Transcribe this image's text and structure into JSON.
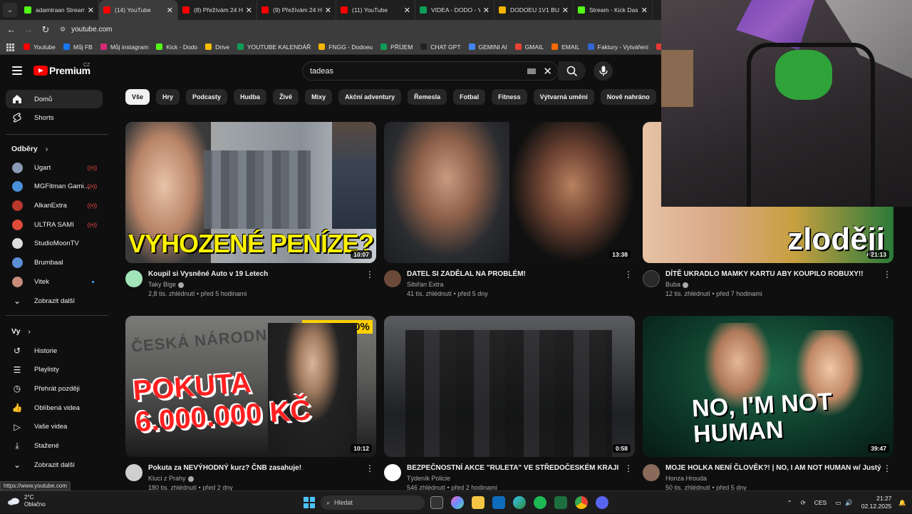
{
  "browser": {
    "tabs": [
      {
        "label": "adamtraan Stream",
        "icon": "kick-icon",
        "color": "#53fc18",
        "active": false
      },
      {
        "label": "(14) YouTube",
        "icon": "youtube-icon",
        "color": "#ff0000",
        "active": true
      },
      {
        "label": "(8) Přežívám 24 H",
        "icon": "youtube-icon",
        "color": "#ff0000",
        "active": false
      },
      {
        "label": "(9) Přežívám 24 H",
        "icon": "youtube-icon",
        "color": "#ff0000",
        "active": false
      },
      {
        "label": "(11) YouTube",
        "icon": "youtube-icon",
        "color": "#ff0000",
        "active": false
      },
      {
        "label": "VIDEA - DODO - Y",
        "icon": "sheets-icon",
        "color": "#0f9d58",
        "active": false
      },
      {
        "label": "DODOEU 1V1 BU",
        "icon": "smile-icon",
        "color": "#f4b400",
        "active": false
      },
      {
        "label": "Stream - Kick Das",
        "icon": "kick-icon",
        "color": "#53fc18",
        "active": false
      }
    ],
    "url": "youtube.com",
    "bookmarks": [
      {
        "label": "Youtube",
        "color": "#ff0000"
      },
      {
        "label": "Můj FB",
        "color": "#1877f2"
      },
      {
        "label": "Můj instagram",
        "color": "#d62976"
      },
      {
        "label": "Kick - Dodo",
        "color": "#53fc18"
      },
      {
        "label": "Drive",
        "color": "#fbbc04"
      },
      {
        "label": "YOUTUBE KALENDÁŘ",
        "color": "#0f9d58"
      },
      {
        "label": "FNGG - Dodoeu",
        "color": "#f4b400"
      },
      {
        "label": "PŘÍJEM",
        "color": "#0f9d58"
      },
      {
        "label": "CHAT GPT",
        "color": "#222222"
      },
      {
        "label": "GEMINI AI",
        "color": "#4285f4"
      },
      {
        "label": "GMAIL",
        "color": "#ea4335"
      },
      {
        "label": "EMAIL",
        "color": "#ff6a00"
      },
      {
        "label": "Faktury - Vytváření",
        "color": "#3367d6"
      },
      {
        "label": "PNG",
        "color": "#e53935"
      }
    ],
    "status_url": "https://www.youtube.com"
  },
  "header": {
    "logo_text": "Premium",
    "country_code": "CZ",
    "search_value": "tadeas"
  },
  "sidebar": {
    "main": [
      {
        "label": "Domů",
        "icon": "home-icon",
        "active": true
      },
      {
        "label": "Shorts",
        "icon": "shorts-icon",
        "active": false
      }
    ],
    "subs_title": "Odběry",
    "subs": [
      {
        "label": "Ugart",
        "color": "#8a9bb5",
        "badge": "live"
      },
      {
        "label": "MGFitman Gami...",
        "color": "#4a90d9",
        "badge": "live"
      },
      {
        "label": "AlkanExtra",
        "color": "#b8382b",
        "badge": "live"
      },
      {
        "label": "ULTRA SAMI",
        "color": "#e04b3a",
        "badge": "live"
      },
      {
        "label": "StudioMoonTV",
        "color": "#dedede",
        "badge": ""
      },
      {
        "label": "Brumbaal",
        "color": "#5c8fd6",
        "badge": ""
      },
      {
        "label": "Vitek",
        "color": "#c98b7a",
        "badge": "new"
      }
    ],
    "show_more": "Zobrazit další",
    "you_title": "Vy",
    "you": [
      {
        "label": "Historie",
        "icon": "history-icon"
      },
      {
        "label": "Playlisty",
        "icon": "playlist-icon"
      },
      {
        "label": "Přehrát později",
        "icon": "clock-icon"
      },
      {
        "label": "Oblíbená videa",
        "icon": "thumbs-up-icon"
      },
      {
        "label": "Vaše videa",
        "icon": "video-icon"
      },
      {
        "label": "Stažené",
        "icon": "download-icon"
      }
    ],
    "you_show_more": "Zobrazit další"
  },
  "chips": [
    "Vše",
    "Hry",
    "Podcasty",
    "Hudba",
    "Živě",
    "Mixy",
    "Akční adventury",
    "Řemesla",
    "Fotbal",
    "Fitness",
    "Výtvarná umění",
    "Nově nahráno",
    "Přehráno"
  ],
  "videos": [
    {
      "title": "Koupil si Vysněné Auto v 19 Letech",
      "channel": "Taky Bige",
      "verified": true,
      "stats": "2,8 tis. zhlédnutí • před 5 hodinami",
      "duration": "10:07",
      "thumb_text": "VYHOZENÉ PENÍZE?",
      "avatar_color": "#a3e4b8"
    },
    {
      "title": "DATEL SI ZADĚLAL NA PROBLÉM!",
      "channel": "Sibiřan Extra",
      "verified": false,
      "stats": "41 tis. zhlédnutí • před 5 dny",
      "duration": "13:38",
      "thumb_text": "",
      "avatar_color": "#6b4a3a"
    },
    {
      "title": "DÍTĚ UKRADLO MAMKY KARTU ABY KOUPILO ROBUXY!!",
      "channel": "Buba",
      "verified": true,
      "stats": "12 tis. zhlédnutí • před 7 hodinami",
      "duration": "21:13",
      "thumb_text": "zloději",
      "avatar_color": "#2a2a2a"
    },
    {
      "title": "Pokuta za NEVÝHODNÝ kurz? ČNB zasahuje!",
      "channel": "Kluci z Prahy",
      "verified": true,
      "stats": "180 tis. zhlédnutí • před 2 dny",
      "duration": "10:12",
      "thumb_text": "POKUTA 6.000.000 KČ",
      "thumb_text_small": "ČESKÁ NÁRODNÍ",
      "thumb_badge": "CHANGE 0%",
      "avatar_color": "#cfcfcf"
    },
    {
      "title": "BEZPEČNOSTNÍ AKCE \"RULETA\" VE STŘEDOČESKÉM KRAJI",
      "channel": "Týdeník Policie",
      "verified": false,
      "stats": "546 zhlédnutí • před 2 hodinami",
      "duration": "0:58",
      "thumb_text": "",
      "avatar_color": "#ffffff"
    },
    {
      "title": "MOJE HOLKA NENÍ ČLOVĚK?! | NO, I AM NOT HUMAN w/ Justý",
      "channel": "Honza Hrouda",
      "verified": false,
      "stats": "50 tis. zhlédnutí • před 5 dny",
      "duration": "39:47",
      "thumb_text": "NO, I'M NOT HUMAN",
      "avatar_color": "#8a6a5a"
    }
  ],
  "taskbar": {
    "weather_temp": "2°C",
    "weather_desc": "Oblačno",
    "search_placeholder": "Hledat",
    "lang": "CES",
    "time": "21:27",
    "date": "02.12.2025"
  }
}
